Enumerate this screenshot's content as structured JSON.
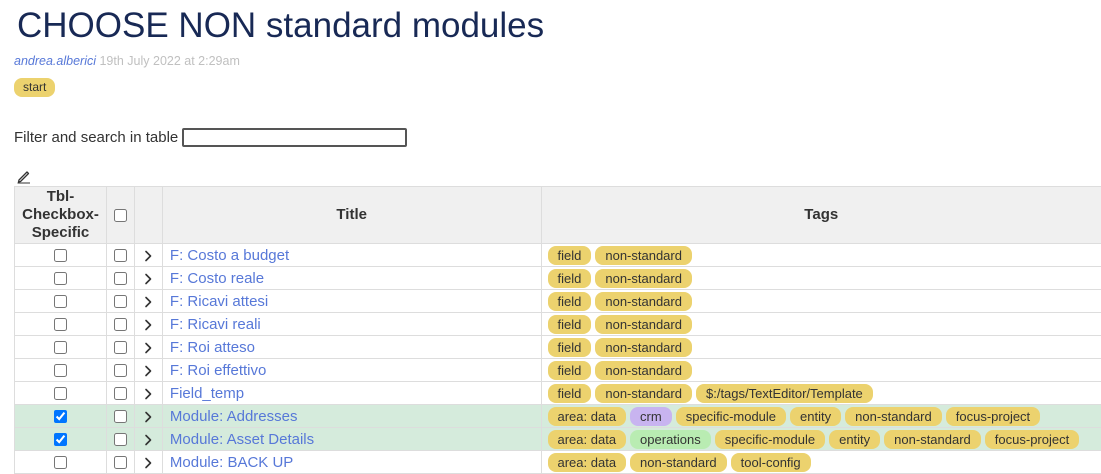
{
  "page": {
    "title": "CHOOSE NON standard modules",
    "author": "andrea.alberici",
    "date": "19th July 2022 at 2:29am",
    "tag": "start"
  },
  "filter": {
    "label": "Filter and search in table",
    "value": ""
  },
  "table": {
    "headers": {
      "checkbox_col": "Tbl-Checkbox-Specific",
      "title": "Title",
      "tags": "Tags"
    },
    "rows": [
      {
        "checked": false,
        "title": "F: Costo a budget",
        "tags": [
          "field",
          "non-standard"
        ]
      },
      {
        "checked": false,
        "title": "F: Costo reale",
        "tags": [
          "field",
          "non-standard"
        ]
      },
      {
        "checked": false,
        "title": "F: Ricavi attesi",
        "tags": [
          "field",
          "non-standard"
        ]
      },
      {
        "checked": false,
        "title": "F: Ricavi reali",
        "tags": [
          "field",
          "non-standard"
        ]
      },
      {
        "checked": false,
        "title": "F: Roi atteso",
        "tags": [
          "field",
          "non-standard"
        ]
      },
      {
        "checked": false,
        "title": "F: Roi effettivo",
        "tags": [
          "field",
          "non-standard"
        ]
      },
      {
        "checked": false,
        "title": "Field_temp",
        "tags": [
          "field",
          "non-standard",
          "$:/tags/TextEditor/Template"
        ]
      },
      {
        "checked": true,
        "title": "Module: Addresses",
        "tags": [
          "area: data",
          "crm",
          "specific-module",
          "entity",
          "non-standard",
          "focus-project"
        ]
      },
      {
        "checked": true,
        "title": "Module: Asset Details",
        "tags": [
          "area: data",
          "operations",
          "specific-module",
          "entity",
          "non-standard",
          "focus-project"
        ]
      },
      {
        "checked": false,
        "title": "Module: BACK UP",
        "tags": [
          "area: data",
          "non-standard",
          "tool-config"
        ]
      }
    ]
  },
  "colors": {
    "title": "#182955",
    "link": "#5778d8",
    "tag_default": "#ecd26e",
    "tag_crm": "#c8b4f0",
    "tag_operations": "#b9ecb2",
    "row_selected": "#d5ebdc",
    "header_bg": "#f0f0f0"
  },
  "icons": {
    "edit": "pencil-edit-icon",
    "expand": "chevron-right-icon"
  }
}
